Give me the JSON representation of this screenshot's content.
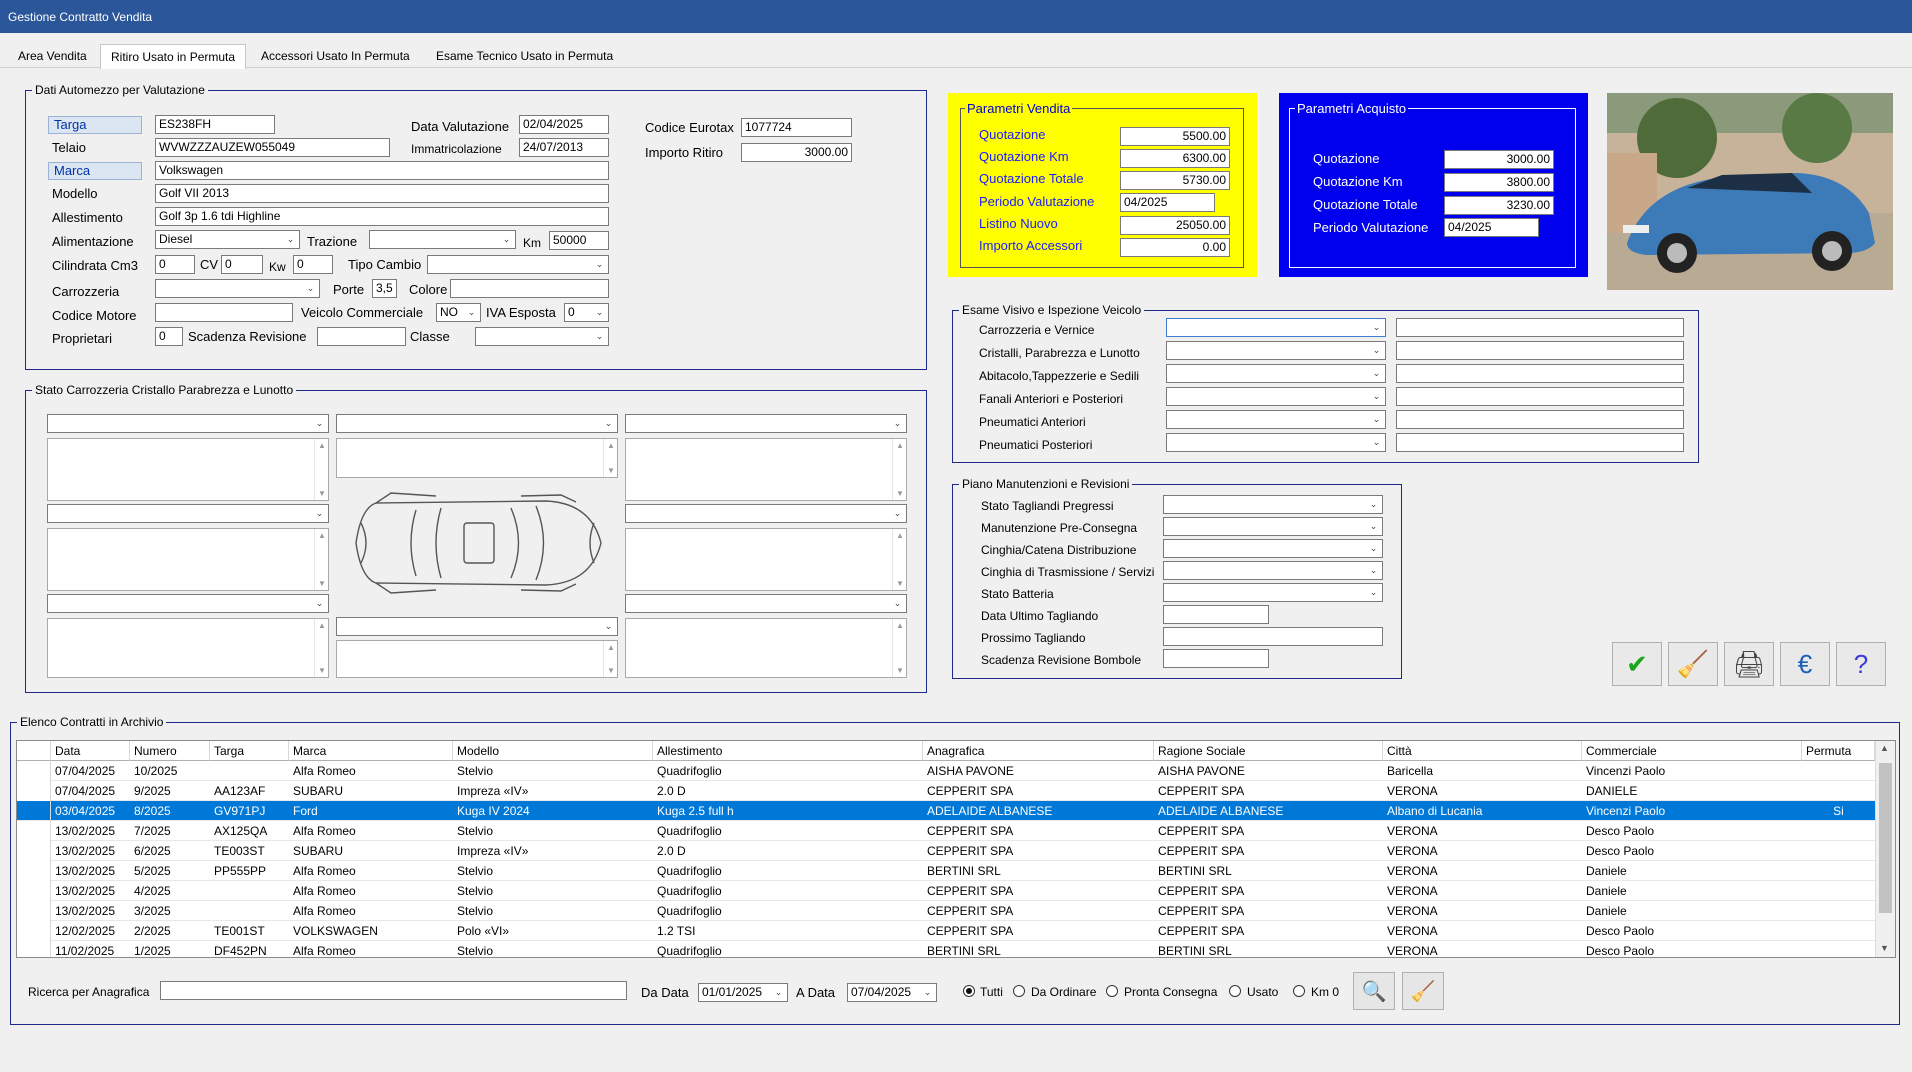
{
  "window": {
    "title": "Gestione Contratto Vendita"
  },
  "tabs": [
    {
      "label": "Area Vendita"
    },
    {
      "label": "Ritiro Usato in Permuta"
    },
    {
      "label": "Accessori Usato In Permuta"
    },
    {
      "label": "Esame Tecnico Usato in Permuta"
    }
  ],
  "dati": {
    "group_label": "Dati Automezzo per Valutazione",
    "targa_label": "Targa",
    "targa": "ES238FH",
    "telaio_label": "Telaio",
    "telaio": "WVWZZZAUZEW055049",
    "marca_label": "Marca",
    "marca": "Volkswagen",
    "modello_label": "Modello",
    "modello": "Golf VII 2013",
    "allestimento_label": "Allestimento",
    "allestimento": "Golf 3p 1.6 tdi Highline",
    "alimentazione_label": "Alimentazione",
    "alimentazione": "Diesel",
    "trazione_label": "Trazione",
    "trazione": "",
    "km_label": "Km",
    "km": "50000",
    "cilindrata_label": "Cilindrata Cm3",
    "cilindrata": "0",
    "cv_label": "CV",
    "cv": "0",
    "kw_label": "Kw",
    "kw": "0",
    "tipo_cambio_label": "Tipo Cambio",
    "tipo_cambio": "",
    "carrozzeria_label": "Carrozzeria",
    "carrozzeria": "",
    "porte_label": "Porte",
    "porte": "3,5",
    "colore_label": "Colore",
    "colore": "",
    "codice_motore_label": "Codice Motore",
    "codice_motore": "",
    "veicolo_commerciale_label": "Veicolo Commerciale",
    "veicolo_commerciale": "NO",
    "iva_esposta_label": "IVA Esposta",
    "iva_esposta": "0",
    "proprietari_label": "Proprietari",
    "proprietari": "0",
    "scadenza_revisione_label": "Scadenza Revisione",
    "scadenza_revisione": "",
    "classe_label": "Classe",
    "classe": "",
    "data_valutazione_label": "Data Valutazione",
    "data_valutazione": "02/04/2025",
    "immatricolazione_label": "Immatricolazione",
    "immatricolazione": "24/07/2013",
    "codice_eurotax_label": "Codice Eurotax",
    "codice_eurotax": "1077724",
    "importo_ritiro_label": "Importo Ritiro",
    "importo_ritiro": "3000.00"
  },
  "parametri_vendita": {
    "title": "Parametri Vendita",
    "color": "#ffff00",
    "rows": [
      {
        "label": "Quotazione",
        "value": "5500.00"
      },
      {
        "label": "Quotazione Km",
        "value": "6300.00"
      },
      {
        "label": "Quotazione Totale",
        "value": "5730.00"
      },
      {
        "label": "Periodo Valutazione",
        "value": "04/2025"
      },
      {
        "label": "Listino Nuovo",
        "value": "25050.00"
      },
      {
        "label": "Importo Accessori",
        "value": "0.00"
      }
    ]
  },
  "parametri_acquisto": {
    "title": "Parametri  Acquisto",
    "color": "#0000ee",
    "rows": [
      {
        "label": "Quotazione",
        "value": "3000.00"
      },
      {
        "label": "Quotazione Km",
        "value": "3800.00"
      },
      {
        "label": "Quotazione Totale",
        "value": "3230.00"
      },
      {
        "label": "Periodo Valutazione",
        "value": "04/2025"
      }
    ]
  },
  "stato_carrozzeria": {
    "group_label": "Stato Carrozzeria Cristallo Parabrezza e Lunotto"
  },
  "esame_visivo": {
    "group_label": "Esame Visivo e Ispezione Veicolo",
    "rows": [
      {
        "label": "Carrozzeria e Vernice"
      },
      {
        "label": "Cristalli, Parabrezza e Lunotto"
      },
      {
        "label": "Abitacolo,Tappezzerie e Sedili"
      },
      {
        "label": "Fanali Anteriori e Posteriori"
      },
      {
        "label": "Pneumatici Anteriori"
      },
      {
        "label": "Pneumatici Posteriori"
      }
    ]
  },
  "piano": {
    "group_label": "Piano Manutenzioni e Revisioni",
    "rows": [
      {
        "label": "Stato Tagliandi Pregressi"
      },
      {
        "label": "Manutenzione Pre-Consegna"
      },
      {
        "label": "Cinghia/Catena Distribuzione"
      },
      {
        "label": "Cinghia di Trasmissione / Servizi"
      },
      {
        "label": "Stato Batteria"
      },
      {
        "label": "Data Ultimo Tagliando"
      },
      {
        "label": "Prossimo Tagliando"
      },
      {
        "label": "Scadenza Revisione Bombole"
      }
    ]
  },
  "archivio": {
    "group_label": "Elenco Contratti in Archivio",
    "columns": [
      "Data",
      "Numero",
      "Targa",
      "Marca",
      "Modello",
      "Allestimento",
      "Anagrafica",
      "Ragione Sociale",
      "Città",
      "Commerciale",
      "Permuta"
    ],
    "rows": [
      [
        "07/04/2025",
        "10/2025",
        "",
        "Alfa Romeo",
        "Stelvio",
        "Quadrifoglio",
        "AISHA PAVONE",
        "AISHA PAVONE",
        "Baricella",
        "Vincenzi Paolo",
        ""
      ],
      [
        "07/04/2025",
        "9/2025",
        "AA123AF",
        "SUBARU",
        "Impreza «IV»",
        "2.0 D",
        "CEPPERIT SPA",
        "CEPPERIT SPA",
        "VERONA",
        "DANIELE",
        ""
      ],
      [
        "03/04/2025",
        "8/2025",
        "GV971PJ",
        "Ford",
        "Kuga IV 2024",
        "Kuga 2.5 full h",
        "ADELAIDE ALBANESE",
        "ADELAIDE ALBANESE",
        "Albano di Lucania",
        "Vincenzi Paolo",
        "Si"
      ],
      [
        "13/02/2025",
        "7/2025",
        "AX125QA",
        "Alfa Romeo",
        "Stelvio",
        "Quadrifoglio",
        "CEPPERIT SPA",
        "CEPPERIT SPA",
        "VERONA",
        "Desco Paolo",
        ""
      ],
      [
        "13/02/2025",
        "6/2025",
        "TE003ST",
        "SUBARU",
        "Impreza «IV»",
        "2.0 D",
        "CEPPERIT SPA",
        "CEPPERIT SPA",
        "VERONA",
        "Desco Paolo",
        ""
      ],
      [
        "13/02/2025",
        "5/2025",
        "PP555PP",
        "Alfa Romeo",
        "Stelvio",
        "Quadrifoglio",
        "BERTINI SRL",
        "BERTINI SRL",
        "VERONA",
        "Daniele",
        ""
      ],
      [
        "13/02/2025",
        "4/2025",
        "",
        "Alfa Romeo",
        "Stelvio",
        "Quadrifoglio",
        "CEPPERIT SPA",
        "CEPPERIT SPA",
        "VERONA",
        "Daniele",
        ""
      ],
      [
        "13/02/2025",
        "3/2025",
        "",
        "Alfa Romeo",
        "Stelvio",
        "Quadrifoglio",
        "CEPPERIT SPA",
        "CEPPERIT SPA",
        "VERONA",
        "Daniele",
        ""
      ],
      [
        "12/02/2025",
        "2/2025",
        "TE001ST",
        "VOLKSWAGEN",
        "Polo «VI»",
        "1.2 TSI",
        "CEPPERIT SPA",
        "CEPPERIT SPA",
        "VERONA",
        "Desco Paolo",
        ""
      ],
      [
        "11/02/2025",
        "1/2025",
        "DF452PN",
        "Alfa Romeo",
        "Stelvio",
        "Quadrifoglio",
        "BERTINI SRL",
        "BERTINI SRL",
        "VERONA",
        "Desco Paolo",
        ""
      ]
    ],
    "selected_row": 2
  },
  "search": {
    "ricerca_label": "Ricerca per Anagrafica",
    "ricerca_value": "",
    "da_data_label": "Da Data",
    "da_data": "01/01/2025",
    "a_data_label": "A Data",
    "a_data": "07/04/2025",
    "filters": [
      {
        "label": "Tutti",
        "checked": true
      },
      {
        "label": "Da Ordinare",
        "checked": false
      },
      {
        "label": "Pronta Consegna",
        "checked": false
      },
      {
        "label": "Usato",
        "checked": false
      },
      {
        "label": "Km 0",
        "checked": false
      }
    ]
  },
  "icons": {
    "confirm": "checkmark-icon",
    "clear": "broom-icon",
    "print": "printer-icon",
    "currency": "euro-icon",
    "help": "help-icon",
    "search": "magnifier-icon",
    "search_clear": "broom-search-icon"
  }
}
